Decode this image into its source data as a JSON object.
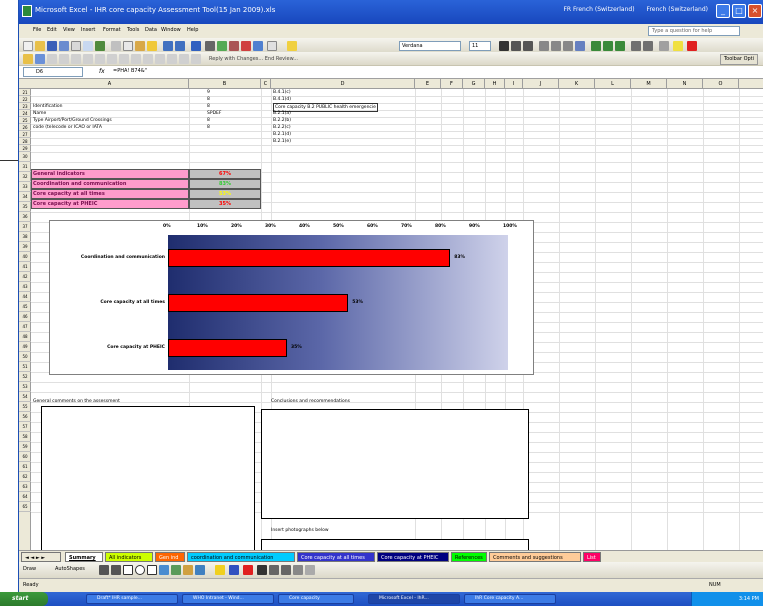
{
  "window": {
    "title": "Microsoft Excel - IHR core capacity Assessment Tool(15 Jan 2009).xls",
    "lang_items": [
      "FR French (Switzerland)",
      "French (Switzerland)"
    ]
  },
  "menu": {
    "items": [
      "File",
      "Edit",
      "View",
      "Insert",
      "Format",
      "Tools",
      "Data",
      "Window",
      "Help"
    ],
    "help_placeholder": "Type a question for help"
  },
  "toolbar": {
    "font_name": "Verdana",
    "font_size": "11",
    "review_label": "Reply with Changes... End Review...",
    "finish_review": "Toolbar Opti"
  },
  "formula_bar": {
    "name_box": "D6",
    "formula": "=PHA! B74&\""
  },
  "columns": [
    "A",
    "B",
    "C",
    "D",
    "E",
    "F",
    "G",
    "H",
    "I",
    "J",
    "K",
    "L",
    "M",
    "N",
    "O"
  ],
  "rows": [
    "21",
    "22",
    "23",
    "24",
    "25",
    "26",
    "27",
    "28",
    "29",
    "30",
    "31",
    "32",
    "33",
    "34",
    "35",
    "36",
    "37",
    "38",
    "39",
    "40",
    "41",
    "42",
    "43",
    "44",
    "45",
    "46",
    "47",
    "48",
    "49",
    "50",
    "51",
    "52",
    "53",
    "54",
    "55",
    "56",
    "57",
    "58",
    "59",
    "60",
    "61",
    "62",
    "63",
    "64",
    "65"
  ],
  "left_cells": [
    {
      "a": "",
      "b": "9"
    },
    {
      "a": "",
      "b": "8"
    },
    {
      "a": "Identification",
      "b": "8"
    },
    {
      "a": "Name",
      "b": "SPDEF"
    },
    {
      "a": "Type Airport/Port/Ground Crossings",
      "b": "8"
    },
    {
      "a": "code (telecode or ICAO or IATA",
      "b": "8"
    }
  ],
  "d_cells": [
    "B.4.1(c)",
    "B.4.1(d)",
    "Core capacity B.2 PUBLIC health emergencie",
    "B.2.1(a)",
    "B.2.2(b)",
    "B.2.2(c)",
    "B.2.1(d)",
    "B.2.1(e)"
  ],
  "indicators": [
    {
      "label": "General indicators",
      "value": "67%",
      "color": "#ff0000"
    },
    {
      "label": "Coordination and communication",
      "value": "83%",
      "color": "#33cc33"
    },
    {
      "label": "Core capacity at all times",
      "value": "53%",
      "color": "#ffff00"
    },
    {
      "label": "Core capacity at PHEIC",
      "value": "35%",
      "color": "#ff0000"
    }
  ],
  "chart_data": {
    "type": "bar",
    "orientation": "horizontal",
    "categories": [
      "Coordination and communication",
      "Core capacity at all times",
      "Core capacity at PHEIC"
    ],
    "values": [
      83,
      53,
      35
    ],
    "value_labels": [
      "83%",
      "53%",
      "35%"
    ],
    "xticks": [
      "0%",
      "10%",
      "20%",
      "30%",
      "40%",
      "50%",
      "60%",
      "70%",
      "80%",
      "90%",
      "100%"
    ],
    "xlim": [
      0,
      100
    ],
    "bar_color": "#ff0000",
    "title": "",
    "xlabel": "",
    "ylabel": ""
  },
  "comments": {
    "general_label": "General comments on the assessment",
    "conclusions_label": "Conclusions and recommendations",
    "photos_label": "Insert photographs below"
  },
  "sheet_tabs": [
    {
      "label": "Summary",
      "bg": "#ffffff",
      "fg": "#000000",
      "active": true
    },
    {
      "label": "All indicators",
      "bg": "#ccff00",
      "fg": "#000000",
      "active": false
    },
    {
      "label": "Gen ind",
      "bg": "#ff6600",
      "fg": "#ffffff",
      "active": false
    },
    {
      "label": "coordination and communication",
      "bg": "#00ccff",
      "fg": "#000000",
      "active": false
    },
    {
      "label": "Core capacity at all times",
      "bg": "#3333cc",
      "fg": "#ffffff",
      "active": false
    },
    {
      "label": "Core capacity at PHEIC",
      "bg": "#000080",
      "fg": "#ffffff",
      "active": false
    },
    {
      "label": "References",
      "bg": "#00ff00",
      "fg": "#000000",
      "active": false
    },
    {
      "label": "Comments and suggestions",
      "bg": "#ffcc99",
      "fg": "#000000",
      "active": false
    },
    {
      "label": "List",
      "bg": "#ff0066",
      "fg": "#ffffff",
      "active": false
    }
  ],
  "draw_bar": {
    "draw": "Draw",
    "autoshapes": "AutoShapes"
  },
  "status": {
    "left": "Ready",
    "right": "NUM"
  },
  "taskbar": {
    "start": "start",
    "tasks": [
      "Draft* IHR sample...",
      "WHO Intranet - Wind...",
      "Core capacity",
      "Microsoft Excel - IhR...",
      "IhR Core capacity A..."
    ],
    "clock": "3:14 PM"
  }
}
